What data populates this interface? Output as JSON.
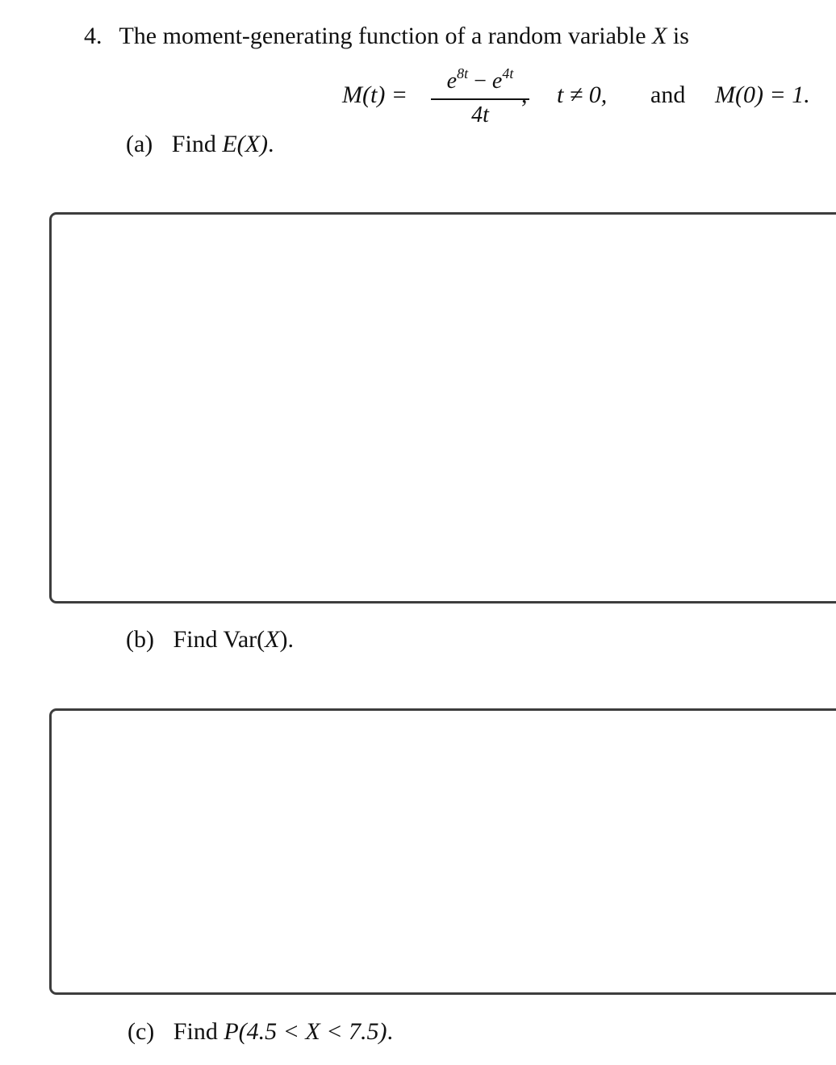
{
  "question": {
    "number": "4.",
    "intro_prefix": "The moment-generating function of a random variable",
    "intro_var": "X",
    "intro_suffix": "is"
  },
  "formula": {
    "lhs": "M(t) =",
    "numerator_base1": "e",
    "numerator_exp1": "8t",
    "numerator_op": "−",
    "numerator_base2": "e",
    "numerator_exp2": "4t",
    "denominator": "4t",
    "comma": ",",
    "condition": "t ≠ 0,",
    "and_word": "and",
    "m0": "M(0) = 1."
  },
  "parts": [
    {
      "label": "(a)",
      "text": "Find",
      "expr": "E(X)",
      "end": "."
    },
    {
      "label": "(b)",
      "text": "Find",
      "expr_plain": "Var(",
      "expr_var": "X",
      "expr_close": ")",
      "end": "."
    },
    {
      "label": "(c)",
      "text": "Find",
      "expr": "P(4.5 < X < 7.5)",
      "end": "."
    }
  ],
  "answer_boxes": [
    {
      "for_part": "(a)",
      "value": ""
    },
    {
      "for_part": "(b)",
      "value": ""
    }
  ]
}
